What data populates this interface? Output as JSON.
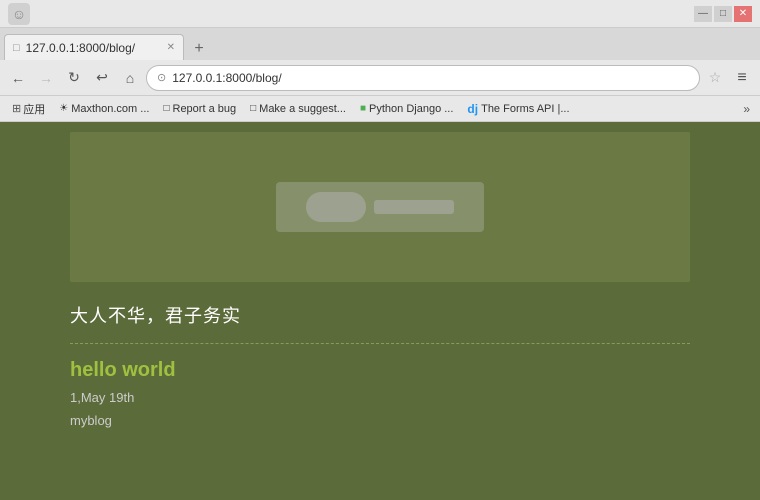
{
  "window": {
    "title": "127.0.0.1:8000/blog/",
    "icon": "☺"
  },
  "titlebar": {
    "minimize": "—",
    "maximize": "□",
    "close": "✕"
  },
  "tab": {
    "favicon": "□",
    "label": "127.0.0.1:8000/blog/",
    "close": "✕"
  },
  "newtab": {
    "label": "+"
  },
  "navbar": {
    "back": "←",
    "forward": "→",
    "refresh": "↻",
    "undo": "↩",
    "home": "⌂",
    "star": "☆",
    "favicon": "⊙",
    "url": "127.0.0.1:8000/blog/",
    "menu": "≡"
  },
  "bookmarks": {
    "apps_label": "应用",
    "items": [
      {
        "icon": "☀",
        "label": "Maxthon.com ..."
      },
      {
        "icon": "□",
        "label": "Report a bug"
      },
      {
        "icon": "□",
        "label": "Make a suggest..."
      },
      {
        "icon": "■",
        "label": "Python Django ..."
      },
      {
        "icon": "d",
        "label": "The Forms API |..."
      }
    ],
    "more": "»"
  },
  "page": {
    "site_title": "大人不华，君子务实",
    "posts": [
      {
        "title": "hello world",
        "meta": "1,May 19th",
        "excerpt": "myblog"
      }
    ]
  }
}
